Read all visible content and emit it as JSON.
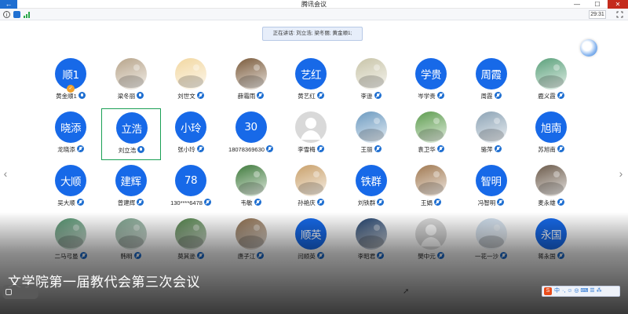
{
  "window": {
    "title": "腾讯会议",
    "back_glyph": "←",
    "minimize_glyph": "—",
    "maximize_glyph": "☐",
    "close_glyph": "✕"
  },
  "status": {
    "info_glyph": "i",
    "timer": "29:31"
  },
  "speaking": {
    "text": "正在讲话: 刘立浩; 梁冬丽; 黄金顺1;"
  },
  "participants": [
    {
      "name": "黄金顺1",
      "type": "blue",
      "avatar_text": "顺1",
      "mic": "on",
      "badge": "ok"
    },
    {
      "name": "梁冬丽",
      "type": "photo",
      "color": "#b7a48a",
      "mic": "on"
    },
    {
      "name": "刘世文",
      "type": "photo",
      "color": "#f2d7a0",
      "mic": "muted"
    },
    {
      "name": "薛霜雨",
      "type": "photo",
      "color": "#7a5a3a",
      "mic": "muted"
    },
    {
      "name": "黄艺红",
      "type": "blue",
      "avatar_text": "艺红",
      "mic": "muted"
    },
    {
      "name": "李逊",
      "type": "photo",
      "color": "#c8c4a8",
      "mic": "muted"
    },
    {
      "name": "岑学贵",
      "type": "blue",
      "avatar_text": "学贵",
      "mic": "muted"
    },
    {
      "name": "周霞",
      "type": "blue",
      "avatar_text": "周霞",
      "mic": "muted"
    },
    {
      "name": "鹿义霞",
      "type": "photo",
      "color": "#5aa07a",
      "mic": "muted"
    },
    {
      "name": "龙晓添",
      "type": "blue",
      "avatar_text": "晓添",
      "mic": "muted"
    },
    {
      "name": "刘立浩",
      "type": "blue",
      "avatar_text": "立浩",
      "mic": "on",
      "highlight": true
    },
    {
      "name": "张小玲",
      "type": "blue",
      "avatar_text": "小玲",
      "mic": "muted"
    },
    {
      "name": "18078369630",
      "type": "blue",
      "avatar_text": "30",
      "mic": "muted"
    },
    {
      "name": "李雪梅",
      "type": "grey",
      "mic": "muted"
    },
    {
      "name": "王丽",
      "type": "photo",
      "color": "#6c9ac0",
      "mic": "muted"
    },
    {
      "name": "袁卫华",
      "type": "photo",
      "color": "#5d9c4e",
      "mic": "muted"
    },
    {
      "name": "骆萍",
      "type": "photo",
      "color": "#8ca3b5",
      "mic": "muted"
    },
    {
      "name": "苏旭南",
      "type": "blue",
      "avatar_text": "旭南",
      "mic": "muted"
    },
    {
      "name": "吴大顺",
      "type": "blue",
      "avatar_text": "大顺",
      "mic": "muted"
    },
    {
      "name": "曾建辉",
      "type": "blue",
      "avatar_text": "建辉",
      "mic": "muted"
    },
    {
      "name": "130****6478",
      "type": "blue",
      "avatar_text": "78",
      "mic": "muted"
    },
    {
      "name": "韦敏",
      "type": "photo",
      "color": "#3f7a3c",
      "mic": "muted"
    },
    {
      "name": "孙艳庆",
      "type": "photo",
      "color": "#c9a06a",
      "mic": "muted"
    },
    {
      "name": "刘铁群",
      "type": "blue",
      "avatar_text": "铁群",
      "mic": "muted"
    },
    {
      "name": "王娟",
      "type": "photo",
      "color": "#a07850",
      "mic": "muted"
    },
    {
      "name": "冯智明",
      "type": "blue",
      "avatar_text": "智明",
      "mic": "muted"
    },
    {
      "name": "麦永雄",
      "type": "photo",
      "color": "#6b5a4a",
      "mic": "muted"
    },
    {
      "name": "二马弓虽",
      "type": "photo",
      "color": "#4f8f6a",
      "mic": "muted"
    },
    {
      "name": "韩明",
      "type": "photo",
      "color": "#7aa08a",
      "mic": "muted"
    },
    {
      "name": "莫其逊",
      "type": "photo",
      "color": "#4e7f46",
      "mic": "muted"
    },
    {
      "name": "唐子江",
      "type": "photo",
      "color": "#8a6a4a",
      "mic": "muted"
    },
    {
      "name": "闫顺英",
      "type": "blue",
      "avatar_text": "顺英",
      "mic": "muted"
    },
    {
      "name": "李昭君",
      "type": "photo",
      "color": "#1f3f6a",
      "mic": "muted"
    },
    {
      "name": "樊中元",
      "type": "grey",
      "mic": "muted"
    },
    {
      "name": "一花一沙",
      "type": "photo",
      "color": "#c8d8e8",
      "mic": "muted"
    },
    {
      "name": "蒋永国",
      "type": "blue",
      "avatar_text": "永国",
      "mic": "muted"
    }
  ],
  "caption": {
    "text": "文学院第一届教代会第三次会议"
  },
  "navigation": {
    "prev_glyph": "‹",
    "next_glyph": "›"
  },
  "ime": {
    "logo": "S",
    "mode": "中",
    "icons": "·, ☺ ◎ ⌨ ☰ ⁂"
  }
}
